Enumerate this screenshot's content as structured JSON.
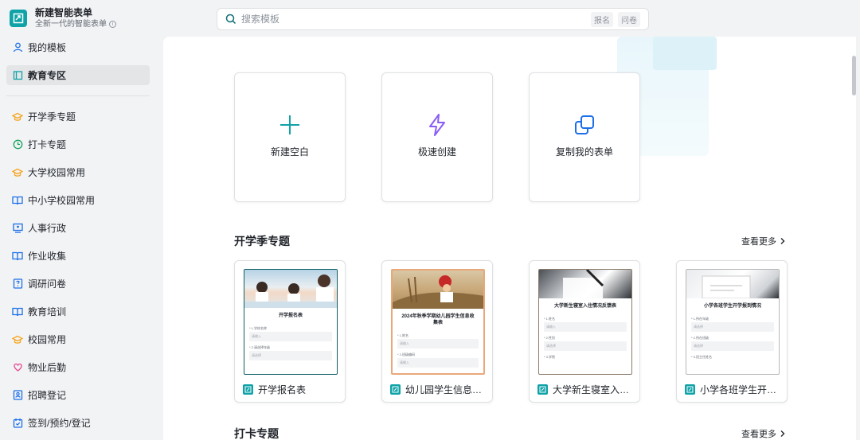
{
  "app": {
    "title": "新建智能表单",
    "subtitle": "全新一代的智能表单"
  },
  "search": {
    "placeholder": "搜索模板",
    "tags": [
      "报名",
      "问卷"
    ]
  },
  "sidebar": {
    "top_items": [
      {
        "label": "我的模板",
        "icon": "user-icon"
      },
      {
        "label": "教育专区",
        "icon": "book-icon",
        "active": true
      }
    ],
    "items": [
      {
        "label": "开学季专题",
        "icon": "graduation-cap-icon"
      },
      {
        "label": "打卡专题",
        "icon": "clock-icon"
      },
      {
        "label": "大学校园常用",
        "icon": "graduation-cap-icon"
      },
      {
        "label": "中小学校园常用",
        "icon": "open-book-icon"
      },
      {
        "label": "人事行政",
        "icon": "monitor-user-icon"
      },
      {
        "label": "作业收集",
        "icon": "open-book-icon"
      },
      {
        "label": "调研问卷",
        "icon": "survey-icon"
      },
      {
        "label": "教育培训",
        "icon": "open-book-icon"
      },
      {
        "label": "校园常用",
        "icon": "graduation-cap-icon"
      },
      {
        "label": "物业后勤",
        "icon": "heart-service-icon"
      },
      {
        "label": "招聘登记",
        "icon": "id-card-icon"
      },
      {
        "label": "签到/预约/登记",
        "icon": "calendar-check-icon"
      }
    ]
  },
  "actions": [
    {
      "label": "新建空白",
      "icon": "plus-icon",
      "color": "#0fa3a8"
    },
    {
      "label": "极速创建",
      "icon": "lightning-icon",
      "color": "#8a5cf6"
    },
    {
      "label": "复制我的表单",
      "icon": "copy-icon",
      "color": "#1c6fe8"
    }
  ],
  "sections": [
    {
      "title": "开学季专题",
      "more": "查看更多",
      "templates": [
        {
          "name": "开学报名表",
          "preview_title": "开学报名表",
          "questions": [
            {
              "label": "* 1.学校名称",
              "placeholder": "请输入"
            },
            {
              "label": "* 2.请选择年级",
              "placeholder": "请选择"
            }
          ]
        },
        {
          "name": "幼儿园学生信息收集",
          "preview_title": "2024年秋季学期幼儿园学生信息收集表",
          "questions": [
            {
              "label": "* 1.姓名",
              "placeholder": "请输入"
            },
            {
              "label": "* 2.班级编码",
              "placeholder": "请输入"
            }
          ]
        },
        {
          "name": "大学新生寝室入住...",
          "preview_title": "大学新生寝室入住情况反馈表",
          "questions": [
            {
              "label": "* 1.姓名",
              "placeholder": "请输入"
            },
            {
              "label": "* 2.性别",
              "placeholder": "请选择"
            },
            {
              "label": "* 3.学院",
              "placeholder": "请选择"
            }
          ]
        },
        {
          "name": "小学各班学生开学...",
          "preview_title": "小学各班学生开学报到情况",
          "questions": [
            {
              "label": "* 1.所在年级",
              "placeholder": "请选择"
            },
            {
              "label": "* 2.所在班级",
              "placeholder": "请选择"
            },
            {
              "label": "* 3.班主任姓名",
              "placeholder": "请输入"
            }
          ]
        }
      ]
    },
    {
      "title": "打卡专题",
      "more": "查看更多"
    }
  ]
}
